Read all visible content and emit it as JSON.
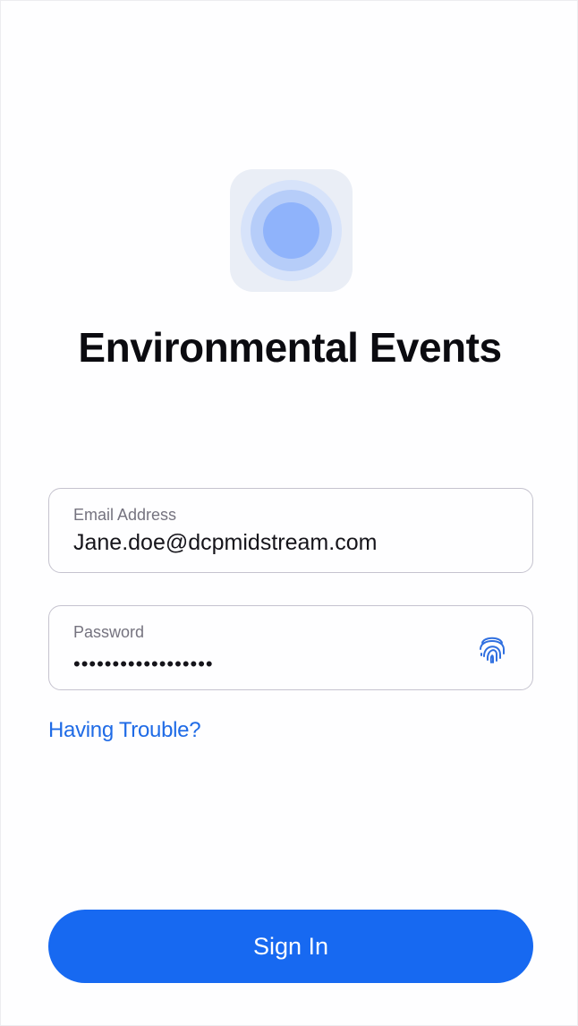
{
  "app": {
    "title": "Environmental Events",
    "logo_icon": "radar-target-icon"
  },
  "login": {
    "email": {
      "label": "Email Address",
      "value": "Jane.doe@dcpmidstream.com"
    },
    "password": {
      "label": "Password",
      "masked_value": "••••••••••••••••••",
      "icon": "fingerprint-icon"
    },
    "trouble_link": "Having Trouble?",
    "submit_label": "Sign In"
  },
  "colors": {
    "accent": "#1769f1",
    "link": "#1f6be6",
    "logo_bg": "#eaeef6",
    "logo_ring": "#8fb3fb"
  }
}
